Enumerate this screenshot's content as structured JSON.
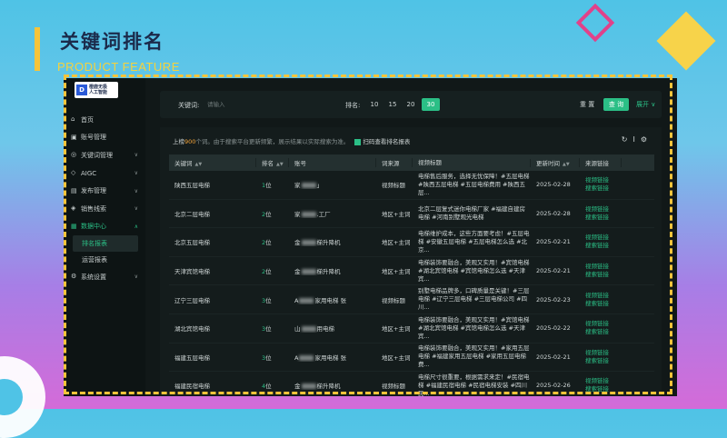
{
  "slide": {
    "title": "关键词排名",
    "subtitle": "PRODUCT FEATURE"
  },
  "logo": {
    "line1": "橙鹿无极",
    "line2": "人工智能"
  },
  "nav": {
    "items": [
      {
        "label": "首页",
        "icon": "home-icon"
      },
      {
        "label": "账号管理",
        "icon": "account-icon"
      },
      {
        "label": "关键词管理",
        "icon": "keyword-icon"
      },
      {
        "label": "AIGC",
        "icon": "aigc-icon"
      },
      {
        "label": "发布管理",
        "icon": "publish-icon"
      },
      {
        "label": "销售线索",
        "icon": "leads-icon"
      },
      {
        "label": "数据中心",
        "icon": "data-icon"
      },
      {
        "label": "系统设置",
        "icon": "settings-icon"
      }
    ],
    "sub": [
      "排名报表",
      "运营报表"
    ]
  },
  "filter": {
    "keyword_label": "关键词:",
    "keyword_placeholder": "请输入",
    "rank_label": "排名:",
    "rank_options": [
      "10",
      "15",
      "20",
      "30"
    ],
    "reset": "重 置",
    "query": "查 询",
    "expand": "展开 ∨"
  },
  "info": {
    "pre": "上榜",
    "count": "900",
    "post": "个词。由于搜索平台更新频繁，展示结果以实际搜索为准。",
    "qr_text": "扫码查看排名报表"
  },
  "table": {
    "headers": [
      "关键词",
      "排名",
      "账号",
      "词来源",
      "视频标题",
      "更新时间",
      "来源链接"
    ],
    "rows": [
      {
        "keyword": "陕西五层电梯",
        "rank": "1",
        "rank_suffix": "位",
        "account_pre": "家",
        "account_post": "」",
        "source": "视频标题",
        "title": "电梯售后服务，选择无忧保障！#五层电梯 #陕西五层电梯 #五层电梯费用 #陕西五层...",
        "date": "2025-02-28"
      },
      {
        "keyword": "北京二层电梯",
        "rank": "2",
        "rank_suffix": "位",
        "account_pre": "家",
        "account_post": ".工厂",
        "source": "地区+主词",
        "title": "北京二层复式迷你电梯厂家 #福建自建房电梯 #河南别墅观光电梯",
        "date": "2025-02-28"
      },
      {
        "keyword": "北京五层电梯",
        "rank": "2",
        "rank_suffix": "位",
        "account_pre": "金",
        "account_post": "梯升降机",
        "source": "地区+主词",
        "title": "电梯维护成本，这些方面要考虑！#五层电梯 #安徽五层电梯 #五层电梯怎么选 #北京...",
        "date": "2025-02-21"
      },
      {
        "keyword": "天津宾馆电梯",
        "rank": "2",
        "rank_suffix": "位",
        "account_pre": "金",
        "account_post": "梯升降机",
        "source": "地区+主词",
        "title": "电梯装饰要融合，美观又实用！#宾馆电梯 #湖北宾馆电梯 #宾馆电梯怎么选 #天津宾...",
        "date": "2025-02-21"
      },
      {
        "keyword": "辽宁三层电梯",
        "rank": "3",
        "rank_suffix": "位",
        "account_pre": "A",
        "account_post": "家用电梯 张",
        "source": "视频标题",
        "title": "别墅电梯品牌多，口碑质量是关键！#三层电梯 #辽宁三层电梯 #三层电梯公司 #四川...",
        "date": "2025-02-23"
      },
      {
        "keyword": "湖北宾馆电梯",
        "rank": "3",
        "rank_suffix": "位",
        "account_pre": "山",
        "account_post": "用电梯",
        "source": "地区+主词",
        "title": "电梯装饰要融合，美观又实用！#宾馆电梯 #湖北宾馆电梯 #宾馆电梯怎么选 #天津宾...",
        "date": "2025-02-22"
      },
      {
        "keyword": "福建五层电梯",
        "rank": "3",
        "rank_suffix": "位",
        "account_pre": "A",
        "account_post": "家用电梯 张",
        "source": "地区+主词",
        "title": "电梯装饰要融合，美观又实用！#家用五层电梯 #福建家用五层电梯 #家用五层电梯费...",
        "date": "2025-02-21"
      },
      {
        "keyword": "福建民宿电梯",
        "rank": "4",
        "rank_suffix": "位",
        "account_pre": "金",
        "account_post": "梯升降机",
        "source": "视频标题",
        "title": "电梯尺寸很重要，根据需求来定！#民宿电梯 #福建民宿电梯 #民宿电梯安装 #四川民...",
        "date": "2025-02-26"
      }
    ],
    "link_labels": [
      "视频链接",
      "搜索链接"
    ]
  },
  "colors": {
    "accent": "#2bbf86",
    "highlight": "#f6a53a",
    "title": "#1b2a4a",
    "yellow": "#f6c43a"
  }
}
